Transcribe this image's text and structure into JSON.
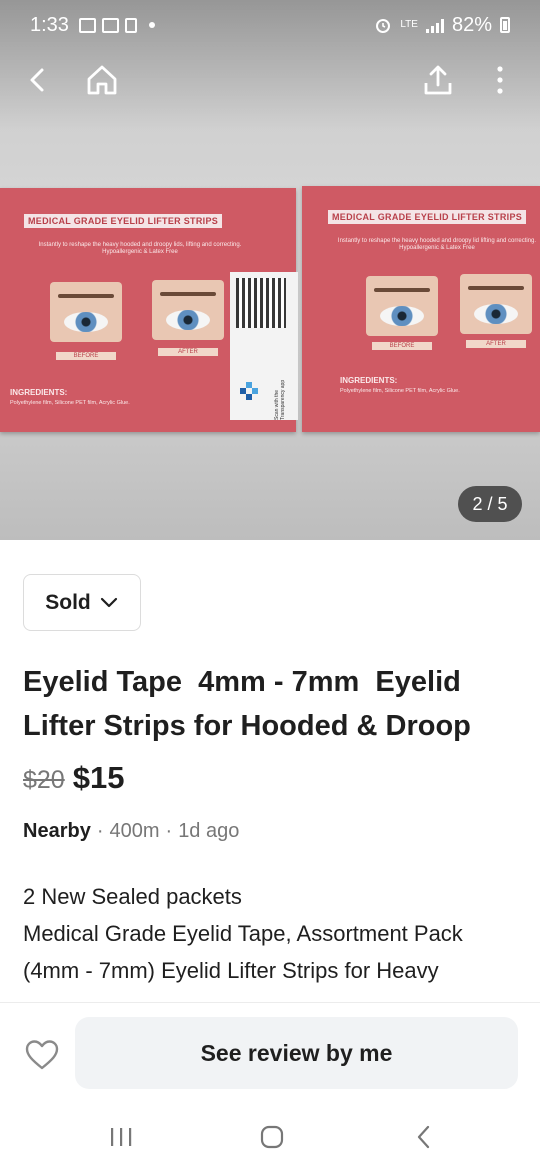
{
  "status_bar": {
    "time": "1:33",
    "network": "LTE",
    "battery": "82%"
  },
  "photo": {
    "counter": "2 / 5",
    "boxes": [
      {
        "title": "MEDICAL GRADE EYELID LIFTER STRIPS",
        "subtitle": "Instantly to reshape the heavy hooded and droopy lids, lifting and correcting. Hypoallergenic & Latex Free",
        "before": "BEFORE",
        "after": "AFTER",
        "ingredients_label": "INGREDIENTS:",
        "ingredients": "Polyethylene film, Silicone PET film, Acrylic Glue.",
        "scan_text": "Scan with the Transparency app"
      },
      {
        "title": "MEDICAL GRADE EYELID LIFTER STRIPS",
        "subtitle": "Instantly to reshape the heavy hooded and droopy lid lifting and correcting. Hypoallergenic & Latex Free",
        "before": "BEFORE",
        "after": "AFTER",
        "ingredients_label": "INGREDIENTS:",
        "ingredients": "Polyethylene film, Silicone PET film, Acrylic Glue."
      }
    ]
  },
  "listing": {
    "status_chip": "Sold",
    "title": "Eyelid Tape  4mm - 7mm  Eyelid Lifter Strips for Hooded & Droop",
    "price_old": "$20",
    "price_new": "$15",
    "location_label": "Nearby",
    "distance": "400m",
    "posted": "1d ago",
    "meta_separator": "·",
    "description": "2 New Sealed packets\nMedical Grade Eyelid Tape, Assortment Pack (4mm - 7mm) Eyelid Lifter Strips for Heavy"
  },
  "bottom_bar": {
    "review_button": "See review by me"
  },
  "icons": {
    "back": "back-arrow-icon",
    "home": "home-icon",
    "share": "share-icon",
    "more": "more-vertical-icon",
    "chevron": "chevron-down-icon",
    "favorite": "heart-icon"
  }
}
